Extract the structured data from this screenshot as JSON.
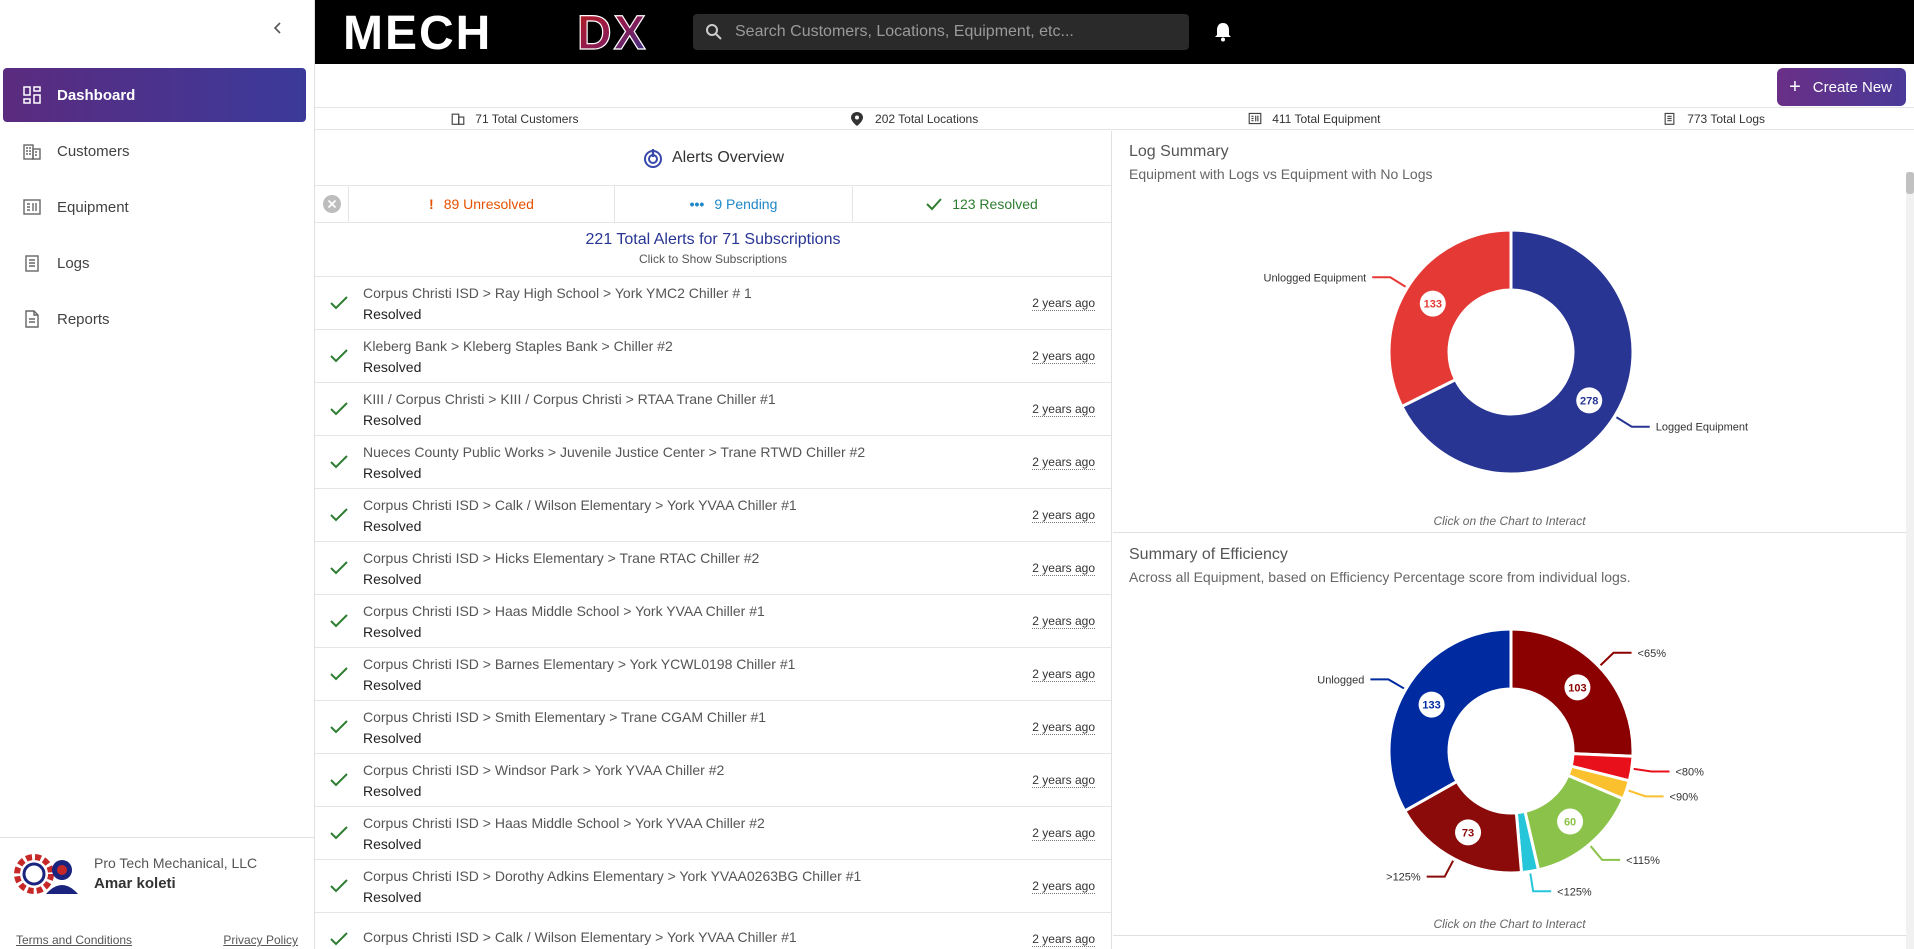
{
  "brand": {
    "name": "MECH DX",
    "part1": "MECH",
    "part2": "DX"
  },
  "search": {
    "placeholder": "Search Customers, Locations, Equipment, etc..."
  },
  "sidebar": {
    "items": [
      {
        "label": "Dashboard",
        "icon": "dashboard-icon",
        "active": true
      },
      {
        "label": "Customers",
        "icon": "building-icon"
      },
      {
        "label": "Equipment",
        "icon": "equipment-icon"
      },
      {
        "label": "Logs",
        "icon": "clipboard-icon"
      },
      {
        "label": "Reports",
        "icon": "file-icon"
      }
    ],
    "company": "Pro Tech Mechanical, LLC",
    "user": "Amar koleti",
    "terms": "Terms and Conditions",
    "privacy": "Privacy Policy"
  },
  "actions": {
    "create_new": "Create New"
  },
  "stats": [
    {
      "label": "71 Total Customers",
      "icon": "building-icon"
    },
    {
      "label": "202 Total Locations",
      "icon": "location-pin-icon"
    },
    {
      "label": "411 Total Equipment",
      "icon": "equipment-icon"
    },
    {
      "label": "773 Total Logs",
      "icon": "clipboard-icon"
    }
  ],
  "alerts": {
    "title": "Alerts Overview",
    "unresolved": "89 Unresolved",
    "pending": "9 Pending",
    "resolved": "123 Resolved",
    "total": "221 Total Alerts for 71 Subscriptions",
    "total_hint": "Click to Show Subscriptions",
    "rows": [
      {
        "path": "Corpus Christi ISD > Ray High School > York YMC2 Chiller # 1",
        "status": "Resolved",
        "when": "2 years ago"
      },
      {
        "path": "Kleberg Bank > Kleberg Staples Bank > Chiller #2",
        "status": "Resolved",
        "when": "2 years ago"
      },
      {
        "path": "KIII / Corpus Christi > KIII / Corpus Christi > RTAA Trane Chiller #1",
        "status": "Resolved",
        "when": "2 years ago"
      },
      {
        "path": "Nueces County Public Works > Juvenile Justice Center > Trane RTWD Chiller #2",
        "status": "Resolved",
        "when": "2 years ago"
      },
      {
        "path": "Corpus Christi ISD > Calk / Wilson Elementary > York YVAA Chiller #1",
        "status": "Resolved",
        "when": "2 years ago"
      },
      {
        "path": "Corpus Christi ISD > Hicks Elementary > Trane RTAC Chiller #2",
        "status": "Resolved",
        "when": "2 years ago"
      },
      {
        "path": "Corpus Christi ISD > Haas Middle School > York YVAA Chiller #1",
        "status": "Resolved",
        "when": "2 years ago"
      },
      {
        "path": "Corpus Christi ISD > Barnes Elementary > York YCWL0198 Chiller #1",
        "status": "Resolved",
        "when": "2 years ago"
      },
      {
        "path": "Corpus Christi ISD > Smith Elementary > Trane CGAM Chiller #1",
        "status": "Resolved",
        "when": "2 years ago"
      },
      {
        "path": "Corpus Christi ISD > Windsor Park > York YVAA Chiller #2",
        "status": "Resolved",
        "when": "2 years ago"
      },
      {
        "path": "Corpus Christi ISD > Haas Middle School > York YVAA Chiller #2",
        "status": "Resolved",
        "when": "2 years ago"
      },
      {
        "path": "Corpus Christi ISD > Dorothy Adkins Elementary > York YVAA0263BG Chiller #1",
        "status": "Resolved",
        "when": "2 years ago"
      },
      {
        "path": "Corpus Christi ISD > Calk / Wilson Elementary > York YVAA Chiller #1",
        "status": "",
        "when": "2 years ago"
      }
    ]
  },
  "log_summary": {
    "title": "Log Summary",
    "subtitle": "Equipment with Logs vs Equipment with No Logs",
    "hint": "Click on the Chart to Interact"
  },
  "efficiency": {
    "title": "Summary of Efficiency",
    "subtitle": "Across all Equipment, based on Efficiency Percentage score from individual logs.",
    "hint": "Click on the Chart to Interact"
  },
  "chart_data": [
    {
      "type": "pie",
      "title": "Log Summary",
      "labels": [
        "Logged Equipment",
        "Unlogged Equipment"
      ],
      "values": [
        278,
        133
      ],
      "colors": [
        "#283593",
        "#e53935"
      ]
    },
    {
      "type": "pie",
      "title": "Summary of Efficiency",
      "labels": [
        "<65%",
        "<80%",
        "<90%",
        "<115%",
        "<125%",
        ">125%",
        "Unlogged"
      ],
      "values": [
        103,
        13,
        10,
        60,
        9,
        73,
        133
      ],
      "colors": [
        "#8b0000",
        "#e8101a",
        "#fbc02d",
        "#8bc34a",
        "#26c6da",
        "#8b0a0a",
        "#002aa0"
      ],
      "data_labels": [
        "103",
        "",
        "",
        "60",
        "",
        "73",
        "133"
      ]
    }
  ]
}
